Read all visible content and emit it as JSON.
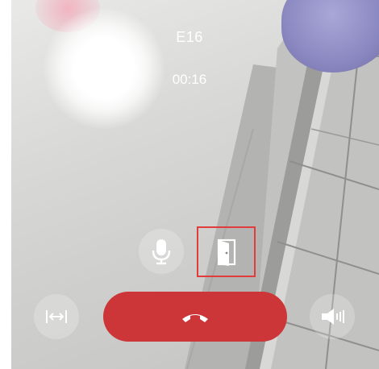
{
  "call": {
    "caller_name": "E16",
    "elapsed_time": "00:16"
  },
  "controls": {
    "mute_icon": "microphone-icon",
    "unlock_icon": "door-icon",
    "resize_icon": "resize-horizontal-icon",
    "hangup_icon": "phone-hangup-icon",
    "speaker_icon": "speaker-icon",
    "hangup_color": "#cc3638",
    "highlight_color": "#e23b3b"
  }
}
